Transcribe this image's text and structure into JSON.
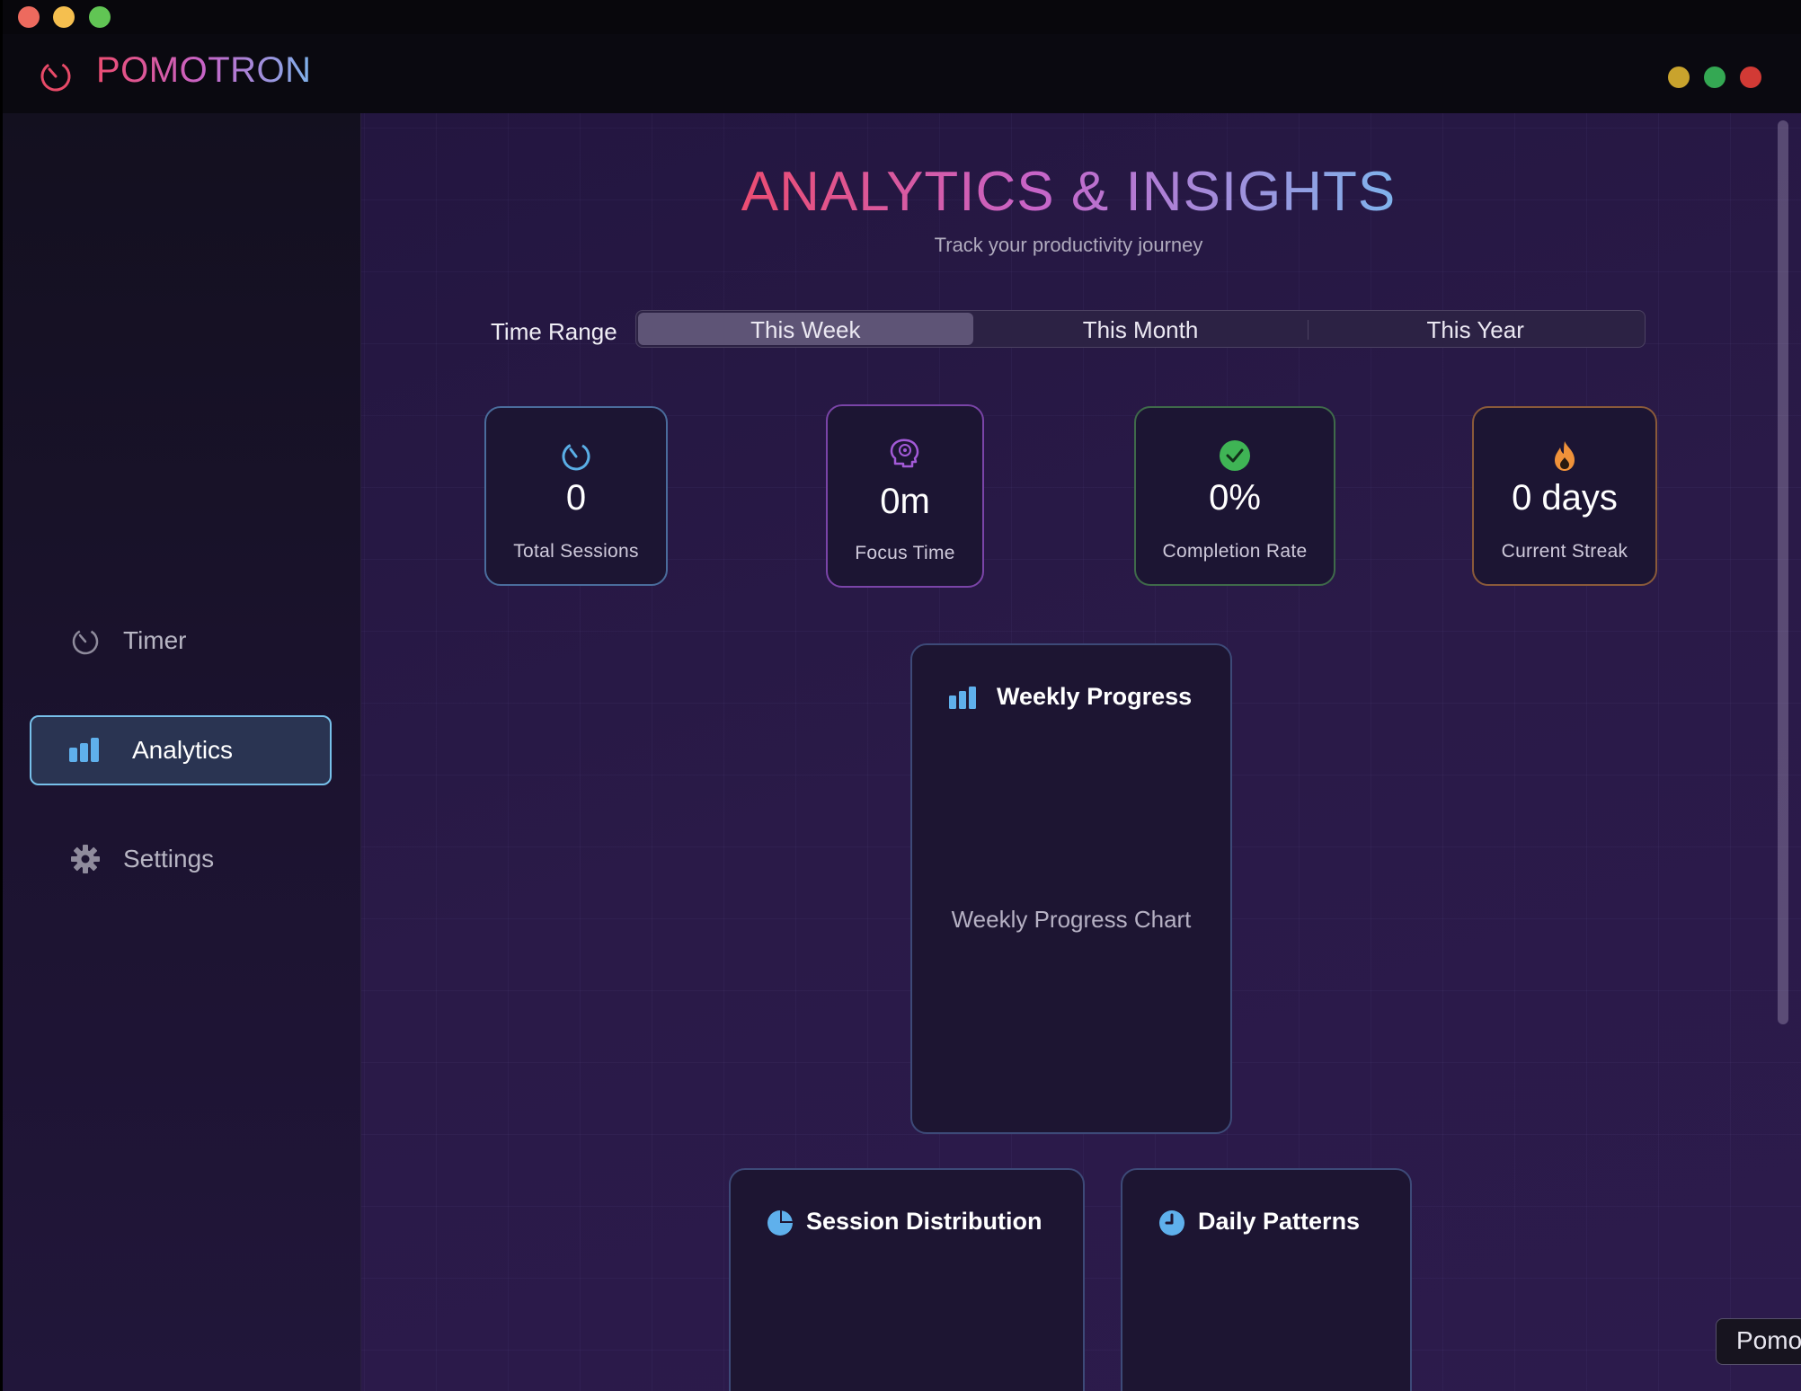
{
  "app": {
    "brand": "POMOTRON"
  },
  "sidebar": {
    "items": [
      {
        "label": "Timer",
        "icon": "timer-icon",
        "active": false
      },
      {
        "label": "Analytics",
        "icon": "bar-chart-icon",
        "active": true
      },
      {
        "label": "Settings",
        "icon": "gear-icon",
        "active": false
      }
    ]
  },
  "header": {
    "title": "ANALYTICS & INSIGHTS",
    "subtitle": "Track your productivity journey"
  },
  "time_range": {
    "label": "Time Range",
    "options": [
      "This Week",
      "This Month",
      "This Year"
    ],
    "selected": "This Week"
  },
  "stats": [
    {
      "value": "0",
      "label": "Total Sessions",
      "icon": "timer-icon",
      "color": "#5aaee6"
    },
    {
      "value": "0m",
      "label": "Focus Time",
      "icon": "brain-icon",
      "color": "#a35ad8"
    },
    {
      "value": "0%",
      "label": "Completion Rate",
      "icon": "check-circle-icon",
      "color": "#3fb455"
    },
    {
      "value": "0 days",
      "label": "Current Streak",
      "icon": "flame-icon",
      "color": "#f0923a"
    }
  ],
  "panels": {
    "weekly": {
      "title": "Weekly Progress",
      "placeholder": "Weekly Progress Chart",
      "icon": "bar-chart-icon"
    },
    "distribution": {
      "title": "Session Distribution",
      "icon": "pie-chart-icon"
    },
    "daily": {
      "title": "Daily Patterns",
      "icon": "clock-icon"
    }
  },
  "floating_button": {
    "label": "Pomo"
  },
  "colors": {
    "accent": "#77c0ea",
    "brand_gradient": [
      "#ec4d72",
      "#c764c8",
      "#7fb3ec"
    ]
  }
}
